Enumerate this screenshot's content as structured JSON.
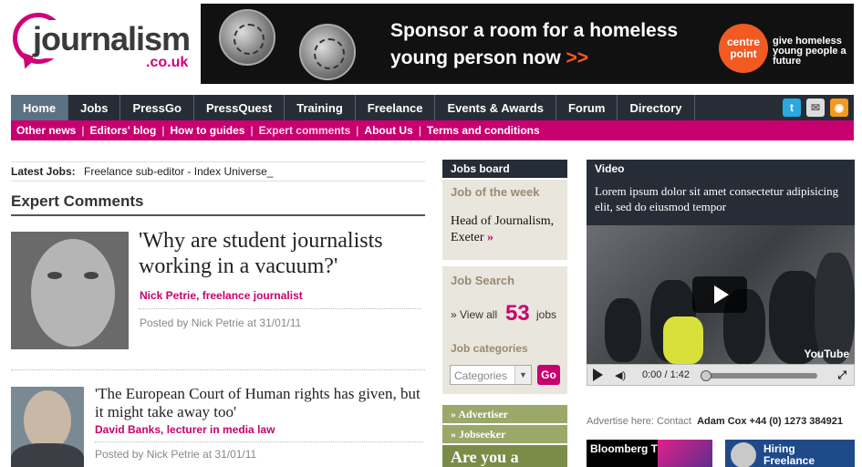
{
  "logo": {
    "word": "journalism",
    "tld": ".co.uk"
  },
  "banner": {
    "line1": "Sponsor a room for a homeless",
    "line2": "young person now",
    "arrows": ">>",
    "charity": "centre point",
    "tagline": "give homeless young people a future",
    "accent": "#f15a22"
  },
  "nav": {
    "items": [
      "Home",
      "Jobs",
      "PressGo",
      "PressQuest",
      "Training",
      "Freelance",
      "Events & Awards",
      "Forum",
      "Directory"
    ],
    "active": "Home",
    "social_icons": [
      "twitter-icon",
      "email-icon",
      "rss-icon"
    ]
  },
  "subnav": {
    "items": [
      "Other news",
      "Editors' blog",
      "How to guides",
      "Expert comments",
      "About Us",
      "Terms and conditions"
    ],
    "current": "Expert comments",
    "color": "#c8006f"
  },
  "latest": {
    "label": "Latest Jobs:",
    "text": "Freelance sub-editor - Index Universe_"
  },
  "section": {
    "title": "Expert Comments"
  },
  "articles": [
    {
      "title": "'Why are student journalists working in a vacuum?'",
      "author": "Nick Petrie, freelance journalist",
      "posted": "Posted by Nick Petrie at 31/01/11"
    },
    {
      "title": "'The European Court of Human rights has given, but it might take away too'",
      "author": "David Banks, lecturer in media law",
      "posted": "Posted by Nick Petrie at 31/01/11"
    }
  ],
  "jobs_board": {
    "header": "Jobs board",
    "job_of_week_label": "Job of the week",
    "job_of_week": "Head of Journalism, Exeter",
    "job_arrow": "»",
    "search_label": "Job Search",
    "view_all": "» View all",
    "count": "53",
    "jobs_word": "jobs",
    "categories_label": "Job categories",
    "select_value": "Categories",
    "go": "Go",
    "advertiser": "Advertiser",
    "jobseeker": "Jobseeker",
    "promo": "Are you a"
  },
  "video": {
    "header": "Video",
    "description": "Lorem ipsum dolor sit amet consectetur adipisicing elit, sed do eiusmod tempor",
    "time": "0:00 / 1:42",
    "provider": "YouTube",
    "progress": 0
  },
  "advertise": {
    "label": "Advertise here: Contact",
    "contact": "Adam Cox +44 (0) 1273 384921"
  },
  "ads": {
    "bloomberg": "Bloomberg THE",
    "hiring": "Hiring Freelance Writers"
  }
}
